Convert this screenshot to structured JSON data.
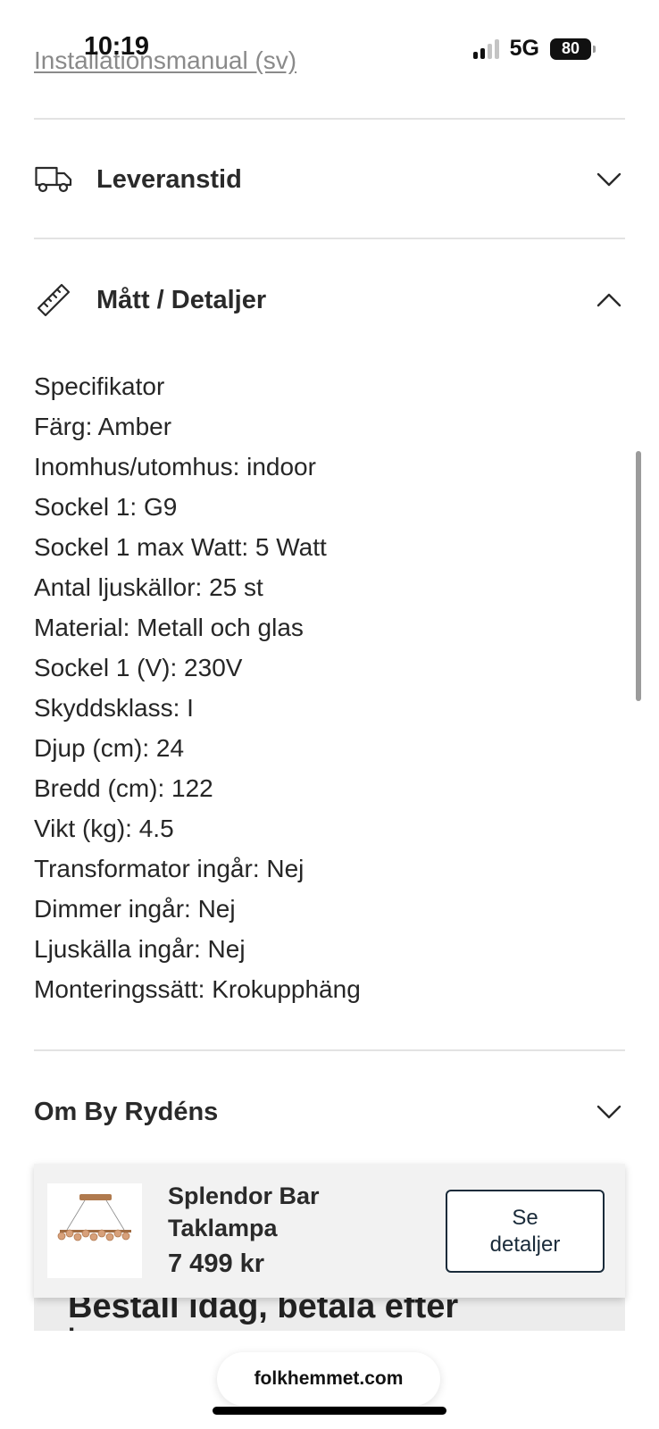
{
  "status_bar": {
    "time": "10:19",
    "network": "5G",
    "battery": "80"
  },
  "links": {
    "installation_manual": "Installationsmanual (sv)"
  },
  "accordions": {
    "delivery": {
      "title": "Leveranstid",
      "icon": "truck-icon",
      "expanded": false
    },
    "dimensions": {
      "title": "Mått / Detaljer",
      "icon": "ruler-icon",
      "expanded": true
    },
    "brand": {
      "title": "Om By Rydéns",
      "expanded": false
    }
  },
  "specs": [
    "Specifikator",
    "Färg: Amber",
    "Inomhus/utomhus: indoor",
    "Sockel 1: G9",
    "Sockel 1 max Watt: 5 Watt",
    "Antal ljuskällor: 25 st",
    "Material: Metall och glas",
    "Sockel 1 (V): 230V",
    "Skyddsklass: I",
    "Djup (cm): 24",
    "Bredd (cm): 122",
    "Vikt (kg): 4.5",
    "Transformator ingår: Nej",
    "Dimmer ingår: Nej",
    "Ljuskälla ingår: Nej",
    "Monteringssätt: Krokupphäng"
  ],
  "sticky_bar": {
    "product_name": "Splendor Bar Taklampa",
    "price": "7 499 kr",
    "details_button": "Se detaljer"
  },
  "partial_banner": {
    "line1": "Beställ idag, betala efter",
    "line2": "l"
  },
  "browser": {
    "url": "folkhemmet.com"
  },
  "colors": {
    "accent_border": "#1a2b3a",
    "divider": "#e3e3e3",
    "link": "#8a8a8a"
  }
}
